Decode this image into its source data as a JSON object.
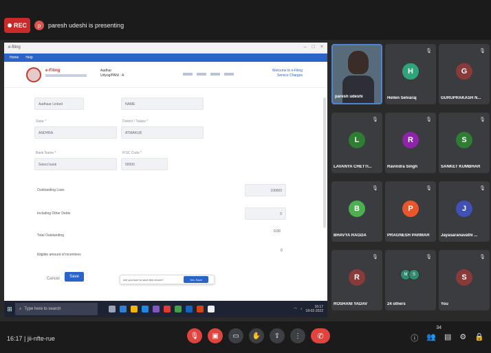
{
  "top": {
    "rec_label": "REC",
    "presenting": "paresh udeshi is presenting",
    "presenter_badge": "p"
  },
  "screen": {
    "window_title": "e-filing",
    "menu": [
      "Home",
      "Help"
    ],
    "logo_text": "e-Filing",
    "header_mid": [
      "Aadhar",
      "Udyog/PAN/ : A"
    ],
    "header_far": [
      "Welcome to e-Filing",
      "Service Charges"
    ],
    "fields": {
      "f1": "Aadhaar Linked",
      "f2": "NAME",
      "lbl_state": "State *",
      "state": "ANDHRA",
      "lbl_district": "District / Taluka *",
      "district": "ATMAKUR",
      "lbl_bank": "Bank Name *",
      "bank": "Select bank",
      "lbl_ifsc": "IFSC Code *",
      "ifsc": "00000"
    },
    "rows": [
      "Outstanding Loan",
      "Including Other Debts",
      "Total Outstanding",
      "Eligible amount of Incentives"
    ],
    "row_values": [
      "100000",
      "0",
      "0.00",
      "0"
    ],
    "cancel": "Cancel",
    "save": "Save",
    "toast_text": "Are you sure to save this record?",
    "toast_btn": "Yes, Save",
    "taskbar_search": "Type here to search",
    "tray_time": "16:17",
    "tray_date": "18-02-2022"
  },
  "tiles": [
    {
      "name": "paresh udeshi",
      "letter": "",
      "color": "",
      "video": true
    },
    {
      "name": "Hellen Selvaraj",
      "letter": "H",
      "color": "#2fa37a",
      "video": false
    },
    {
      "name": "GURUPRAKASH N...",
      "letter": "G",
      "color": "#8b3a3a",
      "video": false
    },
    {
      "name": "LAVANYA CHETTI...",
      "letter": "L",
      "color": "#2e7d32",
      "video": false
    },
    {
      "name": "Ravindra Singh",
      "letter": "R",
      "color": "#8e24aa",
      "video": false
    },
    {
      "name": "SANKET KUMBHAR",
      "letter": "S",
      "color": "#2e7d32",
      "video": false
    },
    {
      "name": "BHAVYA RAGDA",
      "letter": "B",
      "color": "#4caf50",
      "video": false
    },
    {
      "name": "PRAGNESH PARMAR",
      "letter": "P",
      "color": "#e8562b",
      "video": false
    },
    {
      "name": "Jayasaranavathi ...",
      "letter": "J",
      "color": "#3f51b5",
      "video": false
    },
    {
      "name": "ROSHANI YADAV",
      "letter": "R",
      "color": "#8b3a3a",
      "video": false
    },
    {
      "name": "24 others",
      "letter": "",
      "color": "",
      "video": false,
      "pair": [
        "M",
        "S"
      ]
    },
    {
      "name": "You",
      "letter": "S",
      "color": "#8b3a3a",
      "video": false
    }
  ],
  "bottom": {
    "meet_info": "16:17 | jii-nfte-rue",
    "participant_count": "34"
  }
}
